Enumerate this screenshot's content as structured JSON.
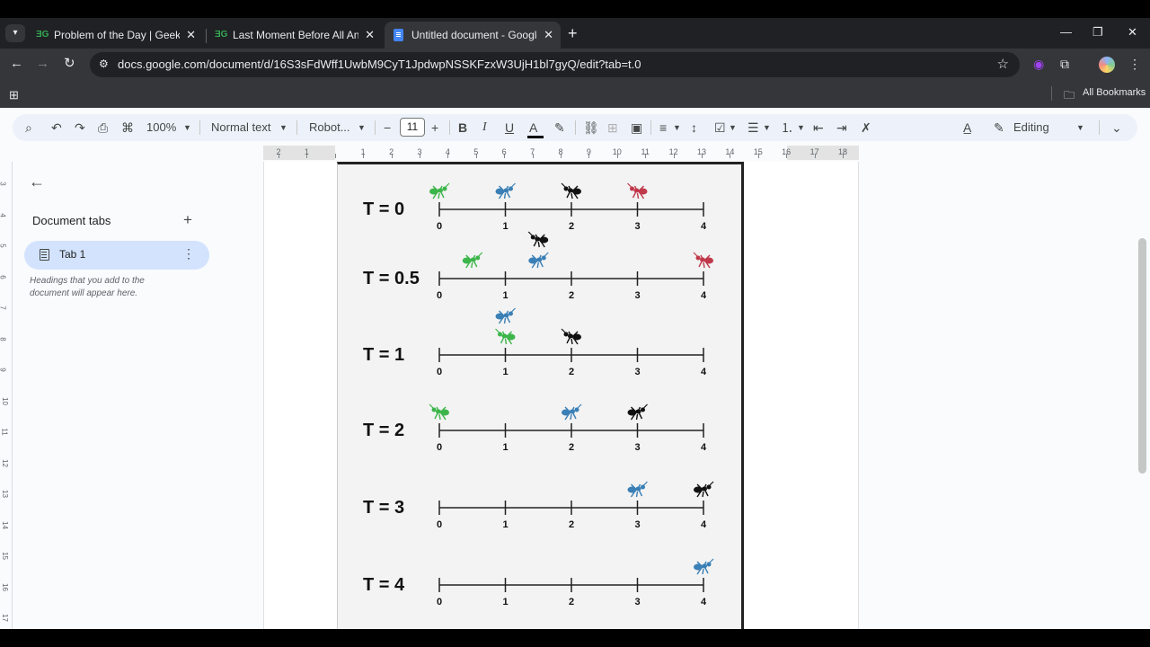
{
  "browser": {
    "tabs": [
      {
        "title": "Problem of the Day | GeeksforG",
        "favicon": "gfg-icon",
        "active": false
      },
      {
        "title": "Last Moment Before All Ants Fa",
        "favicon": "gfg-icon",
        "active": false
      },
      {
        "title": "Untitled document - Google Do",
        "favicon": "docs-icon",
        "active": true
      }
    ],
    "tab_close": "✕",
    "new_tab": "+",
    "url": "docs.google.com/document/d/16S3sFdWff1UwbM9CyT1JpdwpNSSKFzxW3UjH1bl7gyQ/edit?tab=t.0",
    "bookmarks_label": "All Bookmarks"
  },
  "docs_toolbar": {
    "zoom": "100%",
    "style": "Normal text",
    "font": "Robot...",
    "font_size": "11",
    "mode": "Editing"
  },
  "ruler": {
    "numbers": [
      "2",
      "1",
      "",
      "1",
      "2",
      "3",
      "4",
      "5",
      "6",
      "7",
      "8",
      "9",
      "10",
      "11",
      "12",
      "13",
      "14",
      "15",
      "16",
      "17",
      "18"
    ],
    "vertical_numbers": [
      "3",
      "4",
      "5",
      "6",
      "7",
      "8",
      "9",
      "10",
      "11",
      "12",
      "13",
      "14",
      "15",
      "16",
      "17"
    ]
  },
  "sidebar": {
    "heading": "Document tabs",
    "tabs": [
      {
        "label": "Tab 1"
      }
    ],
    "hint": "Headings that you add to the document will appear here."
  },
  "figure": {
    "rows": [
      {
        "label": "T = 0",
        "ants": [
          {
            "pos": 0,
            "color": "green",
            "dir": "right"
          },
          {
            "pos": 1,
            "color": "blue",
            "dir": "right"
          },
          {
            "pos": 2,
            "color": "black",
            "dir": "left"
          },
          {
            "pos": 3,
            "color": "red",
            "dir": "left"
          }
        ]
      },
      {
        "label": "T = 0.5",
        "ants": [
          {
            "pos": 0.5,
            "color": "green",
            "dir": "right"
          },
          {
            "pos": 1.5,
            "color": "blue",
            "dir": "right"
          },
          {
            "pos": 1.5,
            "color": "black",
            "dir": "left",
            "stack": 1
          },
          {
            "pos": 4,
            "color": "red",
            "dir": "left"
          }
        ]
      },
      {
        "label": "T = 1",
        "ants": [
          {
            "pos": 1,
            "color": "green",
            "dir": "left"
          },
          {
            "pos": 1,
            "color": "blue",
            "dir": "right",
            "stack": 1
          },
          {
            "pos": 2,
            "color": "black",
            "dir": "left"
          }
        ]
      },
      {
        "label": "T = 2",
        "ants": [
          {
            "pos": 0,
            "color": "green",
            "dir": "left"
          },
          {
            "pos": 2,
            "color": "blue",
            "dir": "right"
          },
          {
            "pos": 3,
            "color": "black",
            "dir": "right"
          }
        ]
      },
      {
        "label": "T = 3",
        "ants": [
          {
            "pos": 3,
            "color": "blue",
            "dir": "right"
          },
          {
            "pos": 4,
            "color": "black",
            "dir": "right"
          }
        ]
      },
      {
        "label": "T = 4",
        "ants": [
          {
            "pos": 4,
            "color": "blue",
            "dir": "right"
          }
        ]
      }
    ],
    "ticks": [
      "0",
      "1",
      "2",
      "3",
      "4"
    ],
    "ant_colors": {
      "green": "#3cb54a",
      "blue": "#3a7fb5",
      "black": "#111111",
      "red": "#c0394b"
    }
  }
}
